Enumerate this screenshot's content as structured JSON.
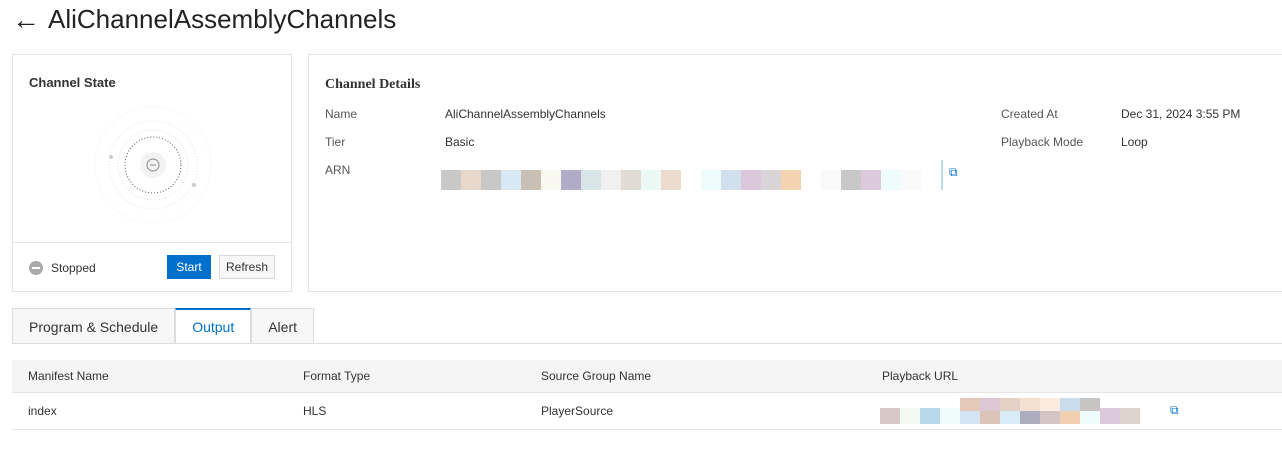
{
  "header": {
    "title": "AliChannelAssemblyChannels",
    "back_icon": "arrow-left-icon"
  },
  "channel_state": {
    "title": "Channel State",
    "status": "Stopped",
    "start_label": "Start",
    "refresh_label": "Refresh"
  },
  "details": {
    "title": "Channel Details",
    "name_label": "Name",
    "name": "AliChannelAssemblyChannels",
    "tier_label": "Tier",
    "tier": "Basic",
    "arn_label": "ARN",
    "created_label": "Created At",
    "created": "Dec 31, 2024 3:55 PM",
    "playback_mode_label": "Playback Mode",
    "playback_mode": "Loop"
  },
  "tabs": [
    {
      "label": "Program & Schedule"
    },
    {
      "label": "Output"
    },
    {
      "label": "Alert"
    }
  ],
  "table": {
    "headers": [
      "Manifest Name",
      "Format Type",
      "Source Group Name",
      "Playback URL"
    ],
    "rows": [
      {
        "manifest": "index",
        "format": "HLS",
        "source_group": "PlayerSource"
      }
    ]
  },
  "colors": {
    "accent": "#0070cc"
  }
}
